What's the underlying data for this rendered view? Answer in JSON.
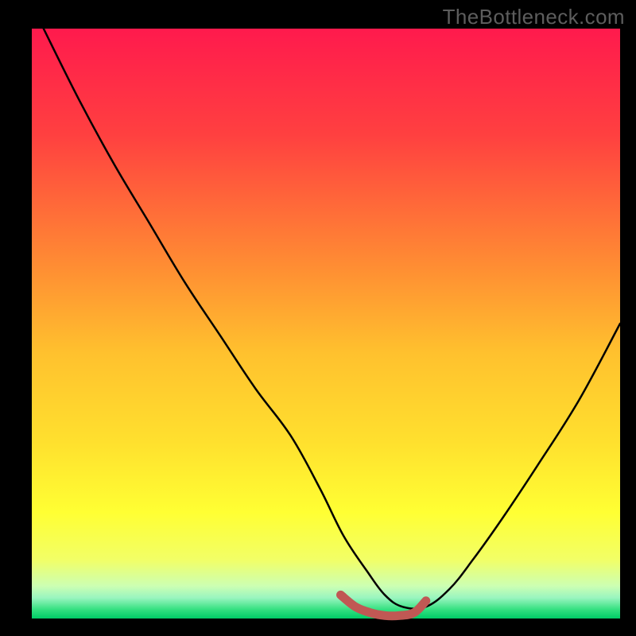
{
  "watermark": "TheBottleneck.com",
  "chart_data": {
    "type": "line",
    "title": "",
    "xlabel": "",
    "ylabel": "",
    "xlim": [
      0,
      100
    ],
    "ylim": [
      0,
      100
    ],
    "background_gradient": {
      "stops": [
        {
          "offset": 0,
          "color": "#ff1a4d"
        },
        {
          "offset": 0.18,
          "color": "#ff4040"
        },
        {
          "offset": 0.4,
          "color": "#ff8c33"
        },
        {
          "offset": 0.55,
          "color": "#ffc12e"
        },
        {
          "offset": 0.7,
          "color": "#ffe02e"
        },
        {
          "offset": 0.82,
          "color": "#ffff33"
        },
        {
          "offset": 0.9,
          "color": "#f2ff66"
        },
        {
          "offset": 0.945,
          "color": "#ccffb3"
        },
        {
          "offset": 0.965,
          "color": "#99f5bf"
        },
        {
          "offset": 0.985,
          "color": "#33e080"
        },
        {
          "offset": 1.0,
          "color": "#00cc66"
        }
      ]
    },
    "series": [
      {
        "name": "bottleneck-curve",
        "color": "#000000",
        "width": 2.5,
        "x": [
          2,
          8,
          14,
          20,
          26,
          32,
          38,
          44,
          49,
          53,
          57,
          60,
          63,
          67,
          71,
          75,
          80,
          86,
          93,
          100
        ],
        "y": [
          100,
          88,
          77,
          67,
          57,
          48,
          39,
          31,
          22,
          14,
          8,
          4,
          2,
          2,
          5,
          10,
          17,
          26,
          37,
          50
        ]
      }
    ],
    "highlight_band": {
      "name": "optimal-range",
      "color": "#c05854",
      "width": 11,
      "x": [
        52.5,
        55,
        57.5,
        60,
        62.5,
        65,
        67
      ],
      "y": [
        4,
        2,
        1,
        0.5,
        0.5,
        1,
        3
      ]
    }
  }
}
